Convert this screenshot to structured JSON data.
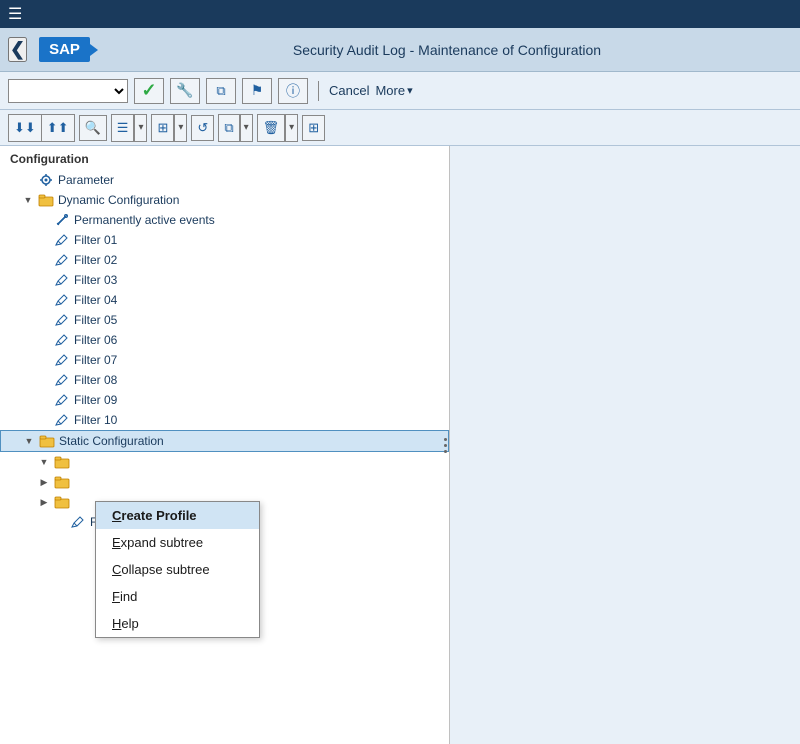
{
  "menubar": {
    "hamburger": "☰"
  },
  "header": {
    "back_arrow": "❮",
    "sap_logo": "SAP",
    "title": "Security Audit Log - Maintenance of Configuration"
  },
  "toolbar": {
    "select_placeholder": "",
    "check_label": "✓",
    "cancel_label": "Cancel",
    "more_label": "More",
    "more_arrow": "▾",
    "icons": {
      "wrench": "🔧",
      "copy": "⧉",
      "flag": "⚑",
      "info": "ⓘ"
    }
  },
  "toolbar2": {
    "btn_expand_all": "⬇⬇",
    "btn_collapse_all": "⬆⬆",
    "btn_search": "🔍",
    "btn_list": "☰",
    "btn_grid": "⊞",
    "btn_refresh": "↺",
    "btn_copy_grp": "⧉",
    "btn_delete_grp": "🗑",
    "btn_extras": "⊞"
  },
  "tree": {
    "root_label": "Configuration",
    "items": [
      {
        "id": "parameter",
        "label": "Parameter",
        "level": 1,
        "type": "item",
        "icon": "gear"
      },
      {
        "id": "dynamic-config",
        "label": "Dynamic Configuration",
        "level": 1,
        "type": "folder",
        "expanded": true
      },
      {
        "id": "perm-events",
        "label": "Permanently active events",
        "level": 2,
        "type": "item-special",
        "icon": "wrench"
      },
      {
        "id": "filter01",
        "label": "Filter 01",
        "level": 2,
        "type": "item",
        "icon": "pencil"
      },
      {
        "id": "filter02",
        "label": "Filter 02",
        "level": 2,
        "type": "item",
        "icon": "pencil"
      },
      {
        "id": "filter03",
        "label": "Filter 03",
        "level": 2,
        "type": "item",
        "icon": "pencil"
      },
      {
        "id": "filter04",
        "label": "Filter 04",
        "level": 2,
        "type": "item",
        "icon": "pencil"
      },
      {
        "id": "filter05",
        "label": "Filter 05",
        "level": 2,
        "type": "item",
        "icon": "pencil"
      },
      {
        "id": "filter06",
        "label": "Filter 06",
        "level": 2,
        "type": "item",
        "icon": "pencil"
      },
      {
        "id": "filter07",
        "label": "Filter 07",
        "level": 2,
        "type": "item",
        "icon": "pencil"
      },
      {
        "id": "filter08",
        "label": "Filter 08",
        "level": 2,
        "type": "item",
        "icon": "pencil"
      },
      {
        "id": "filter09",
        "label": "Filter 09",
        "level": 2,
        "type": "item",
        "icon": "pencil"
      },
      {
        "id": "filter10",
        "label": "Filter 10",
        "level": 2,
        "type": "item",
        "icon": "pencil"
      },
      {
        "id": "static-config",
        "label": "Static Configuration",
        "level": 1,
        "type": "folder",
        "expanded": true,
        "selected": true
      },
      {
        "id": "static-sub1",
        "label": "",
        "level": 2,
        "type": "folder",
        "expanded": true
      },
      {
        "id": "static-sub2",
        "label": "",
        "level": 2,
        "type": "folder",
        "expanded": false
      },
      {
        "id": "static-sub3",
        "label": "",
        "level": 2,
        "type": "folder",
        "expanded": false
      },
      {
        "id": "filter-s1",
        "label": "Filter 01",
        "level": 3,
        "type": "item",
        "icon": "pencil"
      }
    ]
  },
  "context_menu": {
    "items": [
      {
        "id": "create-profile",
        "label": "Create Profile",
        "underline_idx": 0,
        "active": true
      },
      {
        "id": "expand-subtree",
        "label": "Expand subtree",
        "underline_idx": 0
      },
      {
        "id": "collapse-subtree",
        "label": "Collapse subtree",
        "underline_idx": 0
      },
      {
        "id": "find",
        "label": "Find",
        "underline_idx": 0
      },
      {
        "id": "help",
        "label": "Help",
        "underline_idx": 0
      }
    ]
  }
}
